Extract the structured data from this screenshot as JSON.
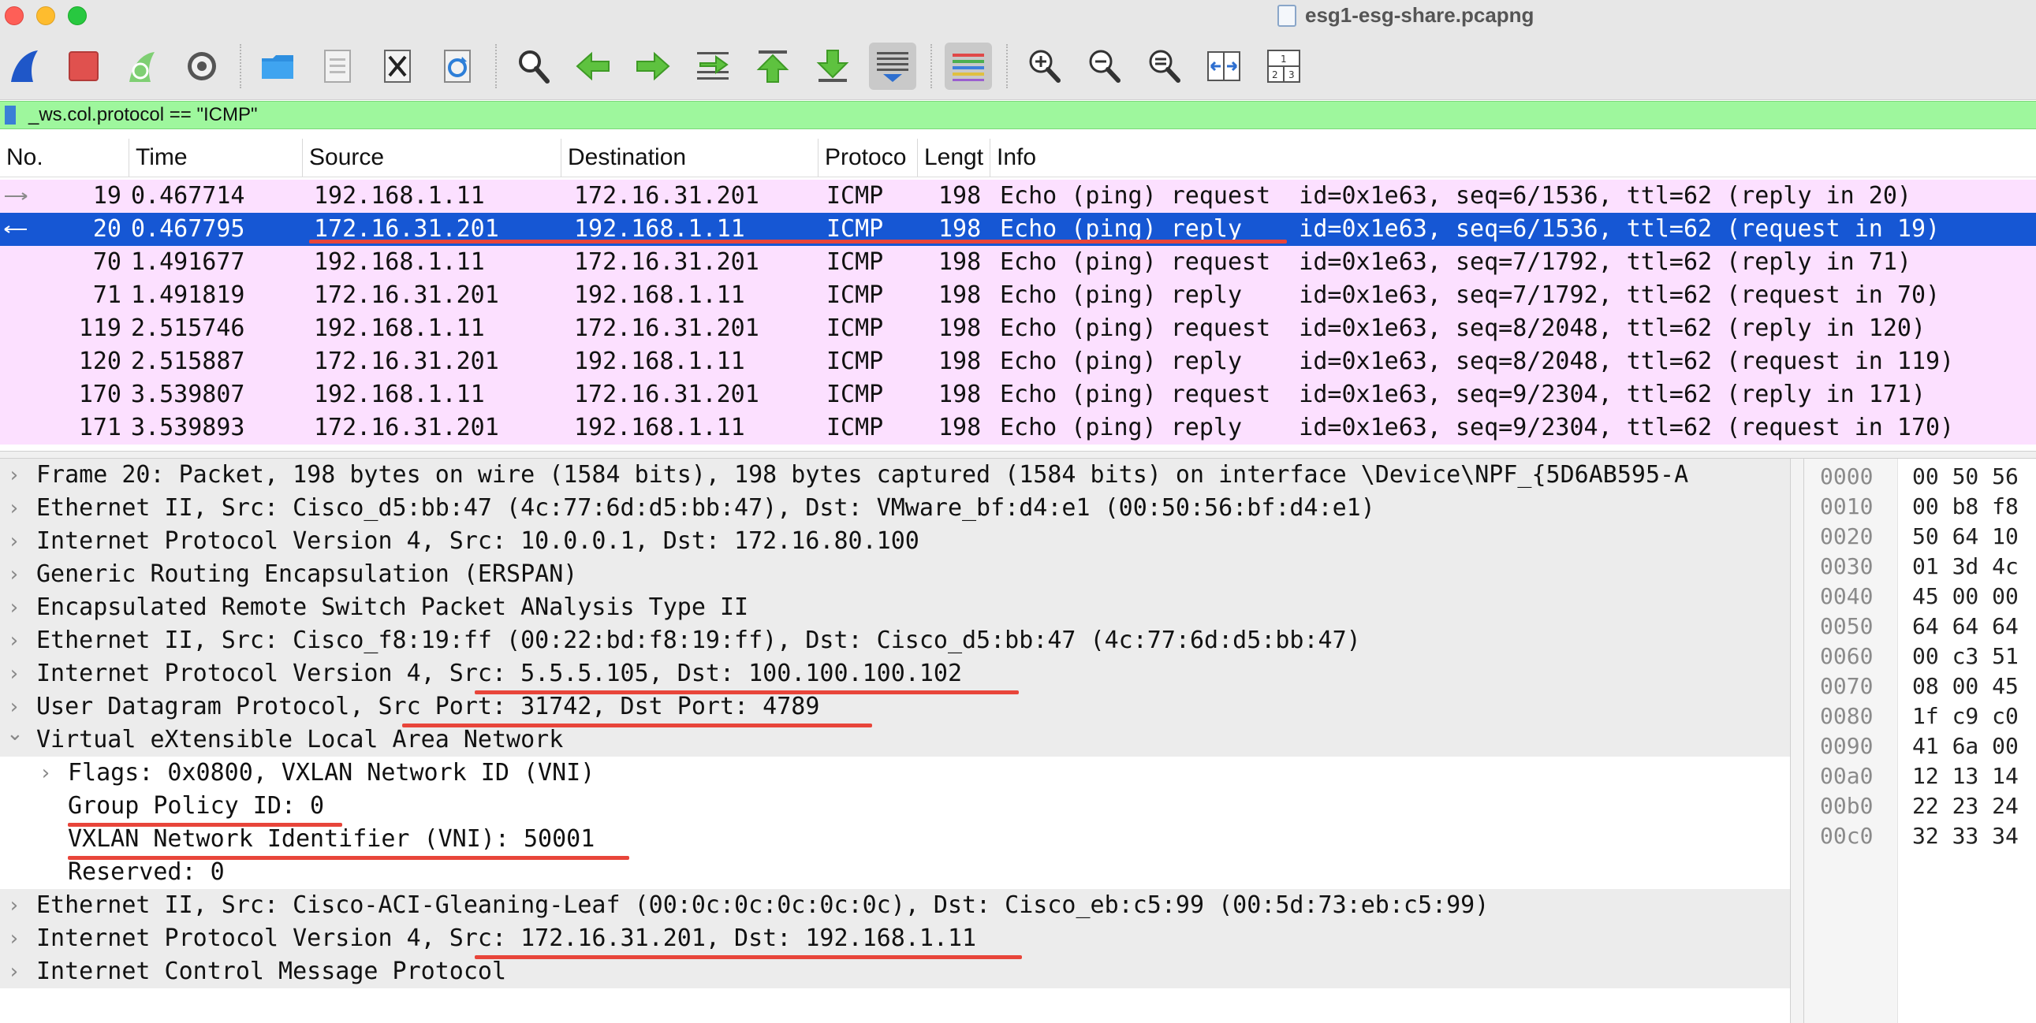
{
  "window": {
    "title": "esg1-esg-share.pcapng"
  },
  "colors": {
    "selected_row": "#1657d4",
    "icmp_row": "#fce0ff",
    "filter_valid": "#9ef79d",
    "annotation": "#e8453a"
  },
  "toolbar": {
    "buttons": [
      "shark-fin-start-icon",
      "stop-capture-icon",
      "restart-capture-icon",
      "capture-options-icon",
      "open-file-icon",
      "save-file-icon",
      "close-file-icon",
      "reload-file-icon",
      "find-packet-icon",
      "go-back-icon",
      "go-forward-icon",
      "go-to-packet-icon",
      "go-first-packet-icon",
      "go-last-packet-icon",
      "auto-scroll-icon",
      "colorize-icon",
      "zoom-in-icon",
      "zoom-out-icon",
      "normal-size-icon",
      "resize-columns-icon",
      "layout-panes-icon"
    ]
  },
  "filter": {
    "value": "_ws.col.protocol == \"ICMP\""
  },
  "packet_list": {
    "columns": [
      "No.",
      "Time",
      "Source",
      "Destination",
      "Protoco",
      "Lengt",
      "Info"
    ],
    "rows": [
      {
        "no": "19",
        "time": "0.467714",
        "src": "192.168.1.11",
        "dst": "172.16.31.201",
        "proto": "ICMP",
        "len": "198",
        "info": "Echo (ping) request  id=0x1e63, seq=6/1536, ttl=62 (reply in 20)",
        "selected": false
      },
      {
        "no": "20",
        "time": "0.467795",
        "src": "172.16.31.201",
        "dst": "192.168.1.11",
        "proto": "ICMP",
        "len": "198",
        "info": "Echo (ping) reply    id=0x1e63, seq=6/1536, ttl=62 (request in 19)",
        "selected": true
      },
      {
        "no": "70",
        "time": "1.491677",
        "src": "192.168.1.11",
        "dst": "172.16.31.201",
        "proto": "ICMP",
        "len": "198",
        "info": "Echo (ping) request  id=0x1e63, seq=7/1792, ttl=62 (reply in 71)",
        "selected": false
      },
      {
        "no": "71",
        "time": "1.491819",
        "src": "172.16.31.201",
        "dst": "192.168.1.11",
        "proto": "ICMP",
        "len": "198",
        "info": "Echo (ping) reply    id=0x1e63, seq=7/1792, ttl=62 (request in 70)",
        "selected": false
      },
      {
        "no": "119",
        "time": "2.515746",
        "src": "192.168.1.11",
        "dst": "172.16.31.201",
        "proto": "ICMP",
        "len": "198",
        "info": "Echo (ping) request  id=0x1e63, seq=8/2048, ttl=62 (reply in 120)",
        "selected": false
      },
      {
        "no": "120",
        "time": "2.515887",
        "src": "172.16.31.201",
        "dst": "192.168.1.11",
        "proto": "ICMP",
        "len": "198",
        "info": "Echo (ping) reply    id=0x1e63, seq=8/2048, ttl=62 (request in 119)",
        "selected": false
      },
      {
        "no": "170",
        "time": "3.539807",
        "src": "192.168.1.11",
        "dst": "172.16.31.201",
        "proto": "ICMP",
        "len": "198",
        "info": "Echo (ping) request  id=0x1e63, seq=9/2304, ttl=62 (reply in 171)",
        "selected": false
      },
      {
        "no": "171",
        "time": "3.539893",
        "src": "172.16.31.201",
        "dst": "192.168.1.11",
        "proto": "ICMP",
        "len": "198",
        "info": "Echo (ping) reply    id=0x1e63, seq=9/2304, ttl=62 (request in 170)",
        "selected": false
      }
    ]
  },
  "details": [
    {
      "text": "Frame 20: Packet, 198 bytes on wire (1584 bits), 198 bytes captured (1584 bits) on interface \\Device\\NPF_{5D6AB595-A",
      "indent": 0,
      "expander": "collapsed"
    },
    {
      "text": "Ethernet II, Src: Cisco_d5:bb:47 (4c:77:6d:d5:bb:47), Dst: VMware_bf:d4:e1 (00:50:56:bf:d4:e1)",
      "indent": 0,
      "expander": "collapsed"
    },
    {
      "text": "Internet Protocol Version 4, Src: 10.0.0.1, Dst: 172.16.80.100",
      "indent": 0,
      "expander": "collapsed"
    },
    {
      "text": "Generic Routing Encapsulation (ERSPAN)",
      "indent": 0,
      "expander": "collapsed"
    },
    {
      "text": "Encapsulated Remote Switch Packet ANalysis Type II",
      "indent": 0,
      "expander": "collapsed"
    },
    {
      "text": "Ethernet II, Src: Cisco_f8:19:ff (00:22:bd:f8:19:ff), Dst: Cisco_d5:bb:47 (4c:77:6d:d5:bb:47)",
      "indent": 0,
      "expander": "collapsed"
    },
    {
      "text": "Internet Protocol Version 4, Src: 5.5.5.105, Dst: 100.100.100.102",
      "indent": 0,
      "expander": "collapsed"
    },
    {
      "text": "User Datagram Protocol, Src Port: 31742, Dst Port: 4789",
      "indent": 0,
      "expander": "collapsed"
    },
    {
      "text": "Virtual eXtensible Local Area Network",
      "indent": 0,
      "expander": "expanded"
    },
    {
      "text": "Flags: 0x0800, VXLAN Network ID (VNI)",
      "indent": 1,
      "expander": "collapsed"
    },
    {
      "text": "Group Policy ID: 0",
      "indent": 1,
      "expander": "none"
    },
    {
      "text": "VXLAN Network Identifier (VNI): 50001",
      "indent": 1,
      "expander": "none"
    },
    {
      "text": "Reserved: 0",
      "indent": 1,
      "expander": "none"
    },
    {
      "text": "Ethernet II, Src: Cisco-ACI-Gleaning-Leaf (00:0c:0c:0c:0c:0c), Dst: Cisco_eb:c5:99 (00:5d:73:eb:c5:99)",
      "indent": 0,
      "expander": "collapsed"
    },
    {
      "text": "Internet Protocol Version 4, Src: 172.16.31.201, Dst: 192.168.1.11",
      "indent": 0,
      "expander": "collapsed"
    },
    {
      "text": "Internet Control Message Protocol",
      "indent": 0,
      "expander": "collapsed"
    }
  ],
  "hex": {
    "offsets": [
      "0000",
      "0010",
      "0020",
      "0030",
      "0040",
      "0050",
      "0060",
      "0070",
      "0080",
      "0090",
      "00a0",
      "00b0",
      "00c0"
    ],
    "bytes": [
      "00 50 56",
      "00 b8 f8",
      "50 64 10",
      "01 3d 4c",
      "45 00 00",
      "64 64 64",
      "00 c3 51",
      "08 00 45",
      "1f c9 c0",
      "41 6a 00",
      "12 13 14",
      "22 23 24",
      "32 33 34"
    ]
  }
}
